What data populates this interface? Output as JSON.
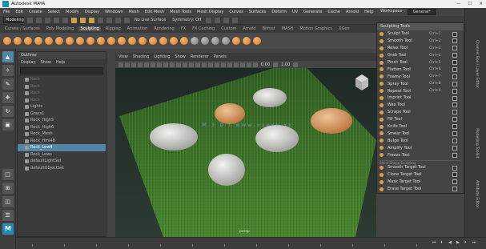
{
  "app": {
    "title": "Autodesk MAYA",
    "window_buttons": [
      "—",
      "☐",
      "✕"
    ]
  },
  "menubar": {
    "items": [
      "File",
      "Edit",
      "Create",
      "Select",
      "Modify",
      "Display",
      "Windows",
      "Mesh",
      "Edit Mesh",
      "Mesh Tools",
      "Mesh Display",
      "Curves",
      "Surfaces",
      "Deform",
      "UV",
      "Generate",
      "Cache",
      "Arnold",
      "Help"
    ],
    "workspace_label": "Workspace :",
    "workspace_value": "General*"
  },
  "statusline": {
    "mode": "Modeling",
    "no_live_surface": "No Live Surface",
    "symmetry": "Symmetry: Off"
  },
  "shelf": {
    "tabs": [
      "Curves / Surfaces",
      "Poly Modeling",
      "Sculpting",
      "Rigging",
      "Animation",
      "Rendering",
      "FX",
      "FX Caching",
      "Custom",
      "Arnold",
      "Bifrost",
      "MASH",
      "Motion Graphics",
      "XGen"
    ],
    "active_tab": "Sculpting"
  },
  "outliner": {
    "title": "Outliner",
    "menus": [
      "Display",
      "Show",
      "Help"
    ],
    "items": [
      {
        "label": "Rock",
        "dim": true
      },
      {
        "label": "Rock",
        "dim": true
      },
      {
        "label": "Rock",
        "dim": true
      },
      {
        "label": "Rock",
        "dim": true
      },
      {
        "label": "Lights",
        "dim": false
      },
      {
        "label": "Grass1",
        "dim": false
      },
      {
        "label": "Rock_High5",
        "dim": false
      },
      {
        "label": "Rock_High6",
        "dim": false
      },
      {
        "label": "Rock_Mesh",
        "dim": false
      },
      {
        "label": "Rock_Hmi4B",
        "dim": false
      },
      {
        "label": "Rock_Low4",
        "dim": false,
        "selected": true
      },
      {
        "label": "Rock_Lows",
        "dim": false
      },
      {
        "label": "defaultLightSet",
        "dim": false
      },
      {
        "label": "defaultObjectSet",
        "dim": false
      }
    ]
  },
  "viewport": {
    "menus": [
      "View",
      "Shading",
      "Lighting",
      "Show",
      "Renderer",
      "Panels"
    ],
    "toolbar_values": [
      "0.00",
      "1.00"
    ],
    "camera_label": "persp",
    "watermark": "M 3 D ! www.xxxxx.xx"
  },
  "sculpt_panel": {
    "title": "Sculpting Tools",
    "tools": [
      {
        "label": "Sculpt Tool",
        "shortcut": "Ctrl+1"
      },
      {
        "label": "Smooth Tool",
        "shortcut": "Ctrl+2"
      },
      {
        "label": "Relax Tool",
        "shortcut": "Ctrl+3"
      },
      {
        "label": "Grab Tool",
        "shortcut": "Ctrl+4"
      },
      {
        "label": "Pinch Tool",
        "shortcut": "Ctrl+5"
      },
      {
        "label": "Flatten Tool",
        "shortcut": "Ctrl+6"
      },
      {
        "label": "Foamy Tool",
        "shortcut": "Ctrl+7"
      },
      {
        "label": "Spray Tool",
        "shortcut": "Ctrl+8"
      },
      {
        "label": "Repeat Tool",
        "shortcut": "Ctrl+9"
      },
      {
        "label": "Imprint Tool",
        "shortcut": ""
      },
      {
        "label": "Wax Tool",
        "shortcut": ""
      },
      {
        "label": "Scrape Tool",
        "shortcut": ""
      },
      {
        "label": "Fill Tool",
        "shortcut": ""
      },
      {
        "label": "Knife Tool",
        "shortcut": ""
      },
      {
        "label": "Smear Tool",
        "shortcut": ""
      },
      {
        "label": "Bulge Tool",
        "shortcut": ""
      },
      {
        "label": "Amplify Tool",
        "shortcut": ""
      },
      {
        "label": "Freeze Tool",
        "shortcut": ""
      }
    ],
    "section_label": "Blend Shape Sculpting",
    "target_tools": [
      {
        "label": "Smooth Target Tool"
      },
      {
        "label": "Clone Target Tool"
      },
      {
        "label": "Mask Target Tool"
      },
      {
        "label": "Erase Target Tool"
      }
    ]
  },
  "right_dock": {
    "tabs": [
      "Channel Box / Layer Editor",
      "Modelling Toolkit",
      "Attribute Editor"
    ]
  },
  "colors": {
    "accent": "#5285a6",
    "maya_blue": "#1a8fb5",
    "grass": "#3c6e27",
    "rock_white": "#d9d9d6",
    "rock_tan": "#d59a66"
  }
}
